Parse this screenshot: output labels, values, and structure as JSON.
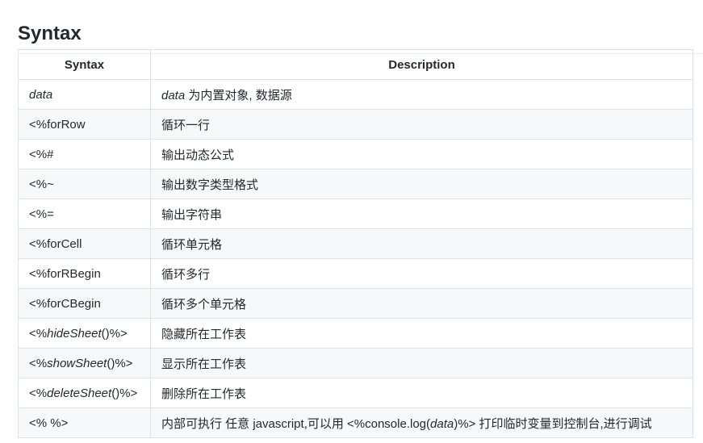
{
  "section": {
    "title": "Syntax"
  },
  "table": {
    "headers": [
      "Syntax",
      "Description"
    ],
    "rows": [
      {
        "syntax": {
          "segments": [
            {
              "text": "data",
              "em": true
            }
          ]
        },
        "description": {
          "segments": [
            {
              "text": "data",
              "em": true
            },
            {
              "text": " 为内置对象, 数据源",
              "em": false
            }
          ]
        }
      },
      {
        "syntax": {
          "segments": [
            {
              "text": "<%forRow",
              "em": false
            }
          ]
        },
        "description": {
          "segments": [
            {
              "text": "循环一行",
              "em": false
            }
          ]
        }
      },
      {
        "syntax": {
          "segments": [
            {
              "text": "<%#",
              "em": false
            }
          ]
        },
        "description": {
          "segments": [
            {
              "text": "输出动态公式",
              "em": false
            }
          ]
        }
      },
      {
        "syntax": {
          "segments": [
            {
              "text": "<%~",
              "em": false
            }
          ]
        },
        "description": {
          "segments": [
            {
              "text": "输出数字类型格式",
              "em": false
            }
          ]
        }
      },
      {
        "syntax": {
          "segments": [
            {
              "text": "<%=",
              "em": false
            }
          ]
        },
        "description": {
          "segments": [
            {
              "text": "输出字符串",
              "em": false
            }
          ]
        }
      },
      {
        "syntax": {
          "segments": [
            {
              "text": "<%forCell",
              "em": false
            }
          ]
        },
        "description": {
          "segments": [
            {
              "text": "循环单元格",
              "em": false
            }
          ]
        }
      },
      {
        "syntax": {
          "segments": [
            {
              "text": "<%forRBegin",
              "em": false
            }
          ]
        },
        "description": {
          "segments": [
            {
              "text": "循环多行",
              "em": false
            }
          ]
        }
      },
      {
        "syntax": {
          "segments": [
            {
              "text": "<%forCBegin",
              "em": false
            }
          ]
        },
        "description": {
          "segments": [
            {
              "text": "循环多个单元格",
              "em": false
            }
          ]
        }
      },
      {
        "syntax": {
          "segments": [
            {
              "text": "<%",
              "em": false
            },
            {
              "text": "hideSheet",
              "em": true
            },
            {
              "text": "()%>",
              "em": false
            }
          ]
        },
        "description": {
          "segments": [
            {
              "text": "隐藏所在工作表",
              "em": false
            }
          ]
        }
      },
      {
        "syntax": {
          "segments": [
            {
              "text": "<%",
              "em": false
            },
            {
              "text": "showSheet",
              "em": true
            },
            {
              "text": "()%>",
              "em": false
            }
          ]
        },
        "description": {
          "segments": [
            {
              "text": "显示所在工作表",
              "em": false
            }
          ]
        }
      },
      {
        "syntax": {
          "segments": [
            {
              "text": "<%",
              "em": false
            },
            {
              "text": "deleteSheet",
              "em": true
            },
            {
              "text": "()%>",
              "em": false
            }
          ]
        },
        "description": {
          "segments": [
            {
              "text": "删除所在工作表",
              "em": false
            }
          ]
        }
      },
      {
        "syntax": {
          "segments": [
            {
              "text": "<% %>",
              "em": false
            }
          ]
        },
        "description": {
          "segments": [
            {
              "text": "内部可执行 任意 javascript,可以用 <%console.log(",
              "em": false
            },
            {
              "text": "data",
              "em": true
            },
            {
              "text": ")%> 打印临时变量到控制台,进行调试",
              "em": false
            }
          ]
        }
      }
    ]
  }
}
